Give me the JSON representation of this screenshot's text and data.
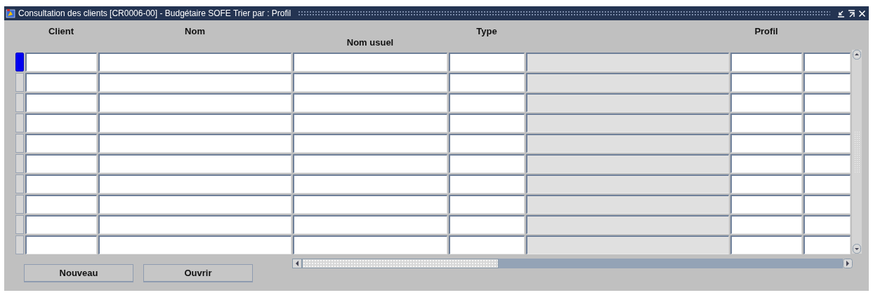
{
  "window": {
    "title": "Consultation des clients [CR0006-00] - Budgétaire SOFE   Trier par : Profil"
  },
  "table": {
    "columns": [
      {
        "label": "Client",
        "kind": "field"
      },
      {
        "label": "Nom",
        "kind": "field"
      },
      {
        "label": "Nom usuel",
        "kind": "field"
      },
      {
        "label": "Type",
        "kind": "field"
      },
      {
        "kind": "readonly"
      },
      {
        "label": "Profil",
        "kind": "field"
      },
      {
        "kind": "field"
      }
    ],
    "rows": [
      {
        "selected": true
      },
      {
        "selected": false
      },
      {
        "selected": false
      },
      {
        "selected": false
      },
      {
        "selected": false
      },
      {
        "selected": false
      },
      {
        "selected": false
      },
      {
        "selected": false
      },
      {
        "selected": false
      },
      {
        "selected": false
      }
    ]
  },
  "buttons": [
    "Nouveau",
    "Ouvrir"
  ]
}
